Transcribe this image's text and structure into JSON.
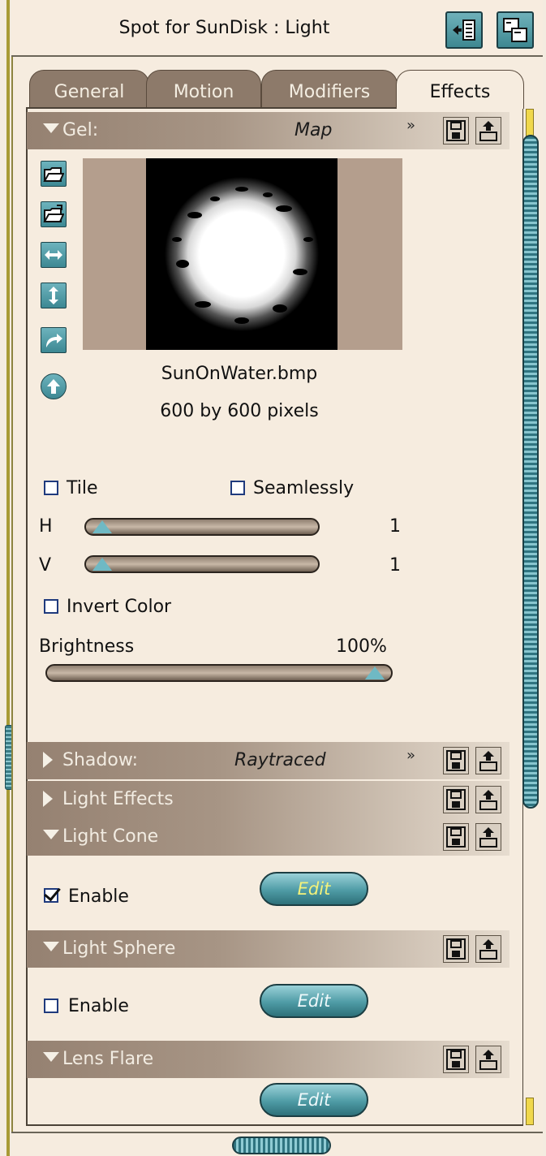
{
  "window": {
    "title": "Spot for SunDisk : Light"
  },
  "tabs": [
    {
      "label": "General"
    },
    {
      "label": "Motion"
    },
    {
      "label": "Modifiers"
    },
    {
      "label": "Effects"
    }
  ],
  "gel": {
    "label": "Gel:",
    "mode": "Map",
    "file_name": "SunOnWater.bmp",
    "dimensions": "600 by 600 pixels",
    "tile_label": "Tile",
    "seamlessly_label": "Seamlessly",
    "h_label": "H",
    "h_value": "1",
    "h_slider_fraction": 0.0,
    "v_label": "V",
    "v_value": "1",
    "v_slider_fraction": 0.0,
    "invert_label": "Invert Color",
    "brightness_label": "Brightness",
    "brightness_value": "100%",
    "brightness_fraction": 1.0
  },
  "shadow": {
    "label": "Shadow:",
    "mode": "Raytraced"
  },
  "light_effects": {
    "label": "Light Effects"
  },
  "light_cone": {
    "label": "Light Cone",
    "enable_label": "Enable",
    "enabled": true,
    "edit_label": "Edit"
  },
  "light_sphere": {
    "label": "Light Sphere",
    "enable_label": "Enable",
    "enabled": false,
    "edit_label": "Edit"
  },
  "lens_flare": {
    "label": "Lens Flare",
    "edit_label": "Edit"
  }
}
